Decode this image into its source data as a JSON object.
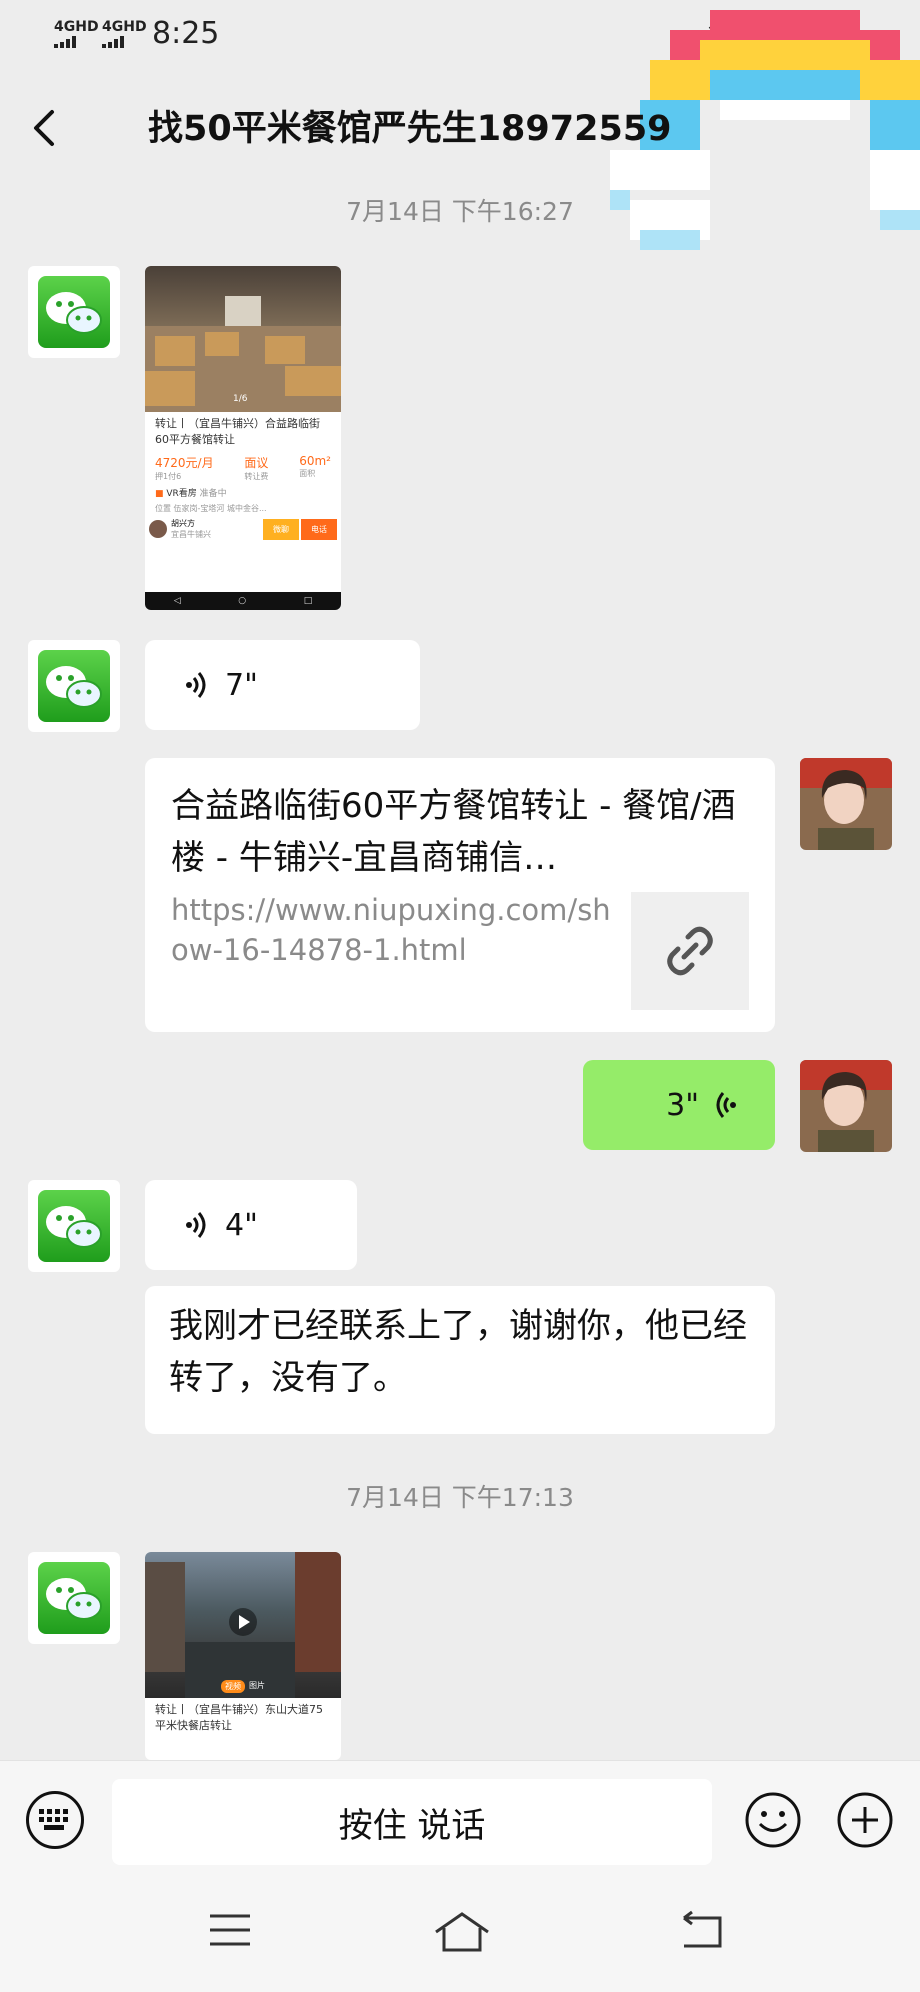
{
  "status_bar": {
    "network_1": "4GHD",
    "network_2": "4GHD",
    "time": "8:25"
  },
  "header": {
    "title": "找50平米餐馆严先生18972559"
  },
  "timestamps": [
    "7月14日 下午16:27",
    "7月14日 下午17:13"
  ],
  "messages": {
    "card1": {
      "caption": "转让丨（宜昌牛铺兴）合益路临街60平方餐馆转让",
      "price": "4720元/月",
      "price_sub": "押1付6",
      "fee": "面议",
      "fee_sub": "转让费",
      "area": "60m²",
      "area_sub": "面积",
      "vr": "VR看房",
      "vr_status": "准备中",
      "location_label": "位置",
      "location": "伍家岗-宝塔河 城中金谷...",
      "agent": "胡兴方",
      "agent_sub": "宜昌牛铺兴",
      "btn_1": "微聊",
      "btn_2": "电话",
      "pager": "1/6"
    },
    "voice1": {
      "duration": "7\""
    },
    "link": {
      "title": "合益路临街60平方餐馆转让 - 餐馆/酒楼 - 牛铺兴-宜昌商铺信…",
      "url": "https://www.niupuxing.com/show-16-14878-1.html"
    },
    "voice_me": {
      "duration": "3\""
    },
    "voice2": {
      "duration": "4\""
    },
    "text1": {
      "text": "我刚才已经联系上了，谢谢你，他已经转了，没有了。"
    },
    "card2": {
      "caption": "转让丨（宜昌牛铺兴）东山大道75平米快餐店转让",
      "tag_1": "视频",
      "tag_2": "图片"
    }
  },
  "input_bar": {
    "hold_to_talk": "按住 说话"
  },
  "colors": {
    "background": "#ededed",
    "my_bubble": "#95ec69",
    "bubble": "#ffffff",
    "accent_orange": "#ff6a1a"
  }
}
